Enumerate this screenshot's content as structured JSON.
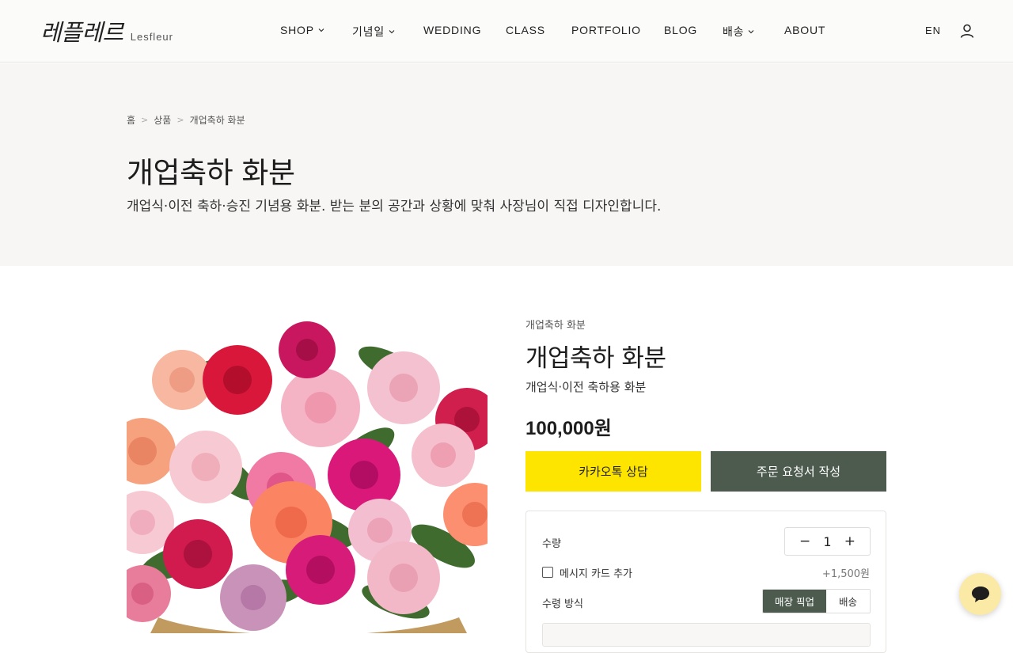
{
  "brand": {
    "name_ko": "레플레르",
    "name_en": "Lesfleur"
  },
  "nav": {
    "items": [
      {
        "label": "SHOP",
        "dropdown": true
      },
      {
        "label": "기념일",
        "dropdown": true
      },
      {
        "label": "WEDDING",
        "dropdown": false
      },
      {
        "label": "CLASS",
        "dropdown": false
      },
      {
        "label": "PORTFOLIO",
        "dropdown": false
      },
      {
        "label": "BLOG",
        "dropdown": false
      },
      {
        "label": "배송",
        "dropdown": true
      },
      {
        "label": "ABOUT",
        "dropdown": false
      }
    ],
    "lang": "EN",
    "user_icon": "user-icon"
  },
  "breadcrumb": {
    "items": [
      "홈",
      "상품",
      "개업축하 화분"
    ],
    "separator": ">"
  },
  "hero": {
    "title": "개업축하 화분",
    "description": "개업식·이전 축하·승진 기념용 화분. 받는 분의 공간과 상황에 맞춰 사장님이 직접 디자인합니다."
  },
  "product": {
    "category": "개업축하 화분",
    "title": "개업축하 화분",
    "subtitle": "개업식·이전 축하용 화분",
    "price": "100,000원",
    "image_alt": "rose-basket",
    "buttons": {
      "kakao": "카카오톡 상담",
      "order": "주문 요청서 작성"
    }
  },
  "options": {
    "quantity_label": "수량",
    "quantity": "1",
    "minus": "−",
    "plus": "+",
    "card_label": "메시지 카드 추가",
    "card_price": "+1,500원",
    "card_checked": false,
    "receive_label": "수령 방식",
    "receive_options": [
      "매장 픽업",
      "배송"
    ],
    "receive_selected": "매장 픽업"
  },
  "colors": {
    "kakao": "#fee500",
    "accent": "#4d5b4f",
    "chat": "#fbe9a6"
  },
  "chat_icon": "chat-bubble-icon"
}
